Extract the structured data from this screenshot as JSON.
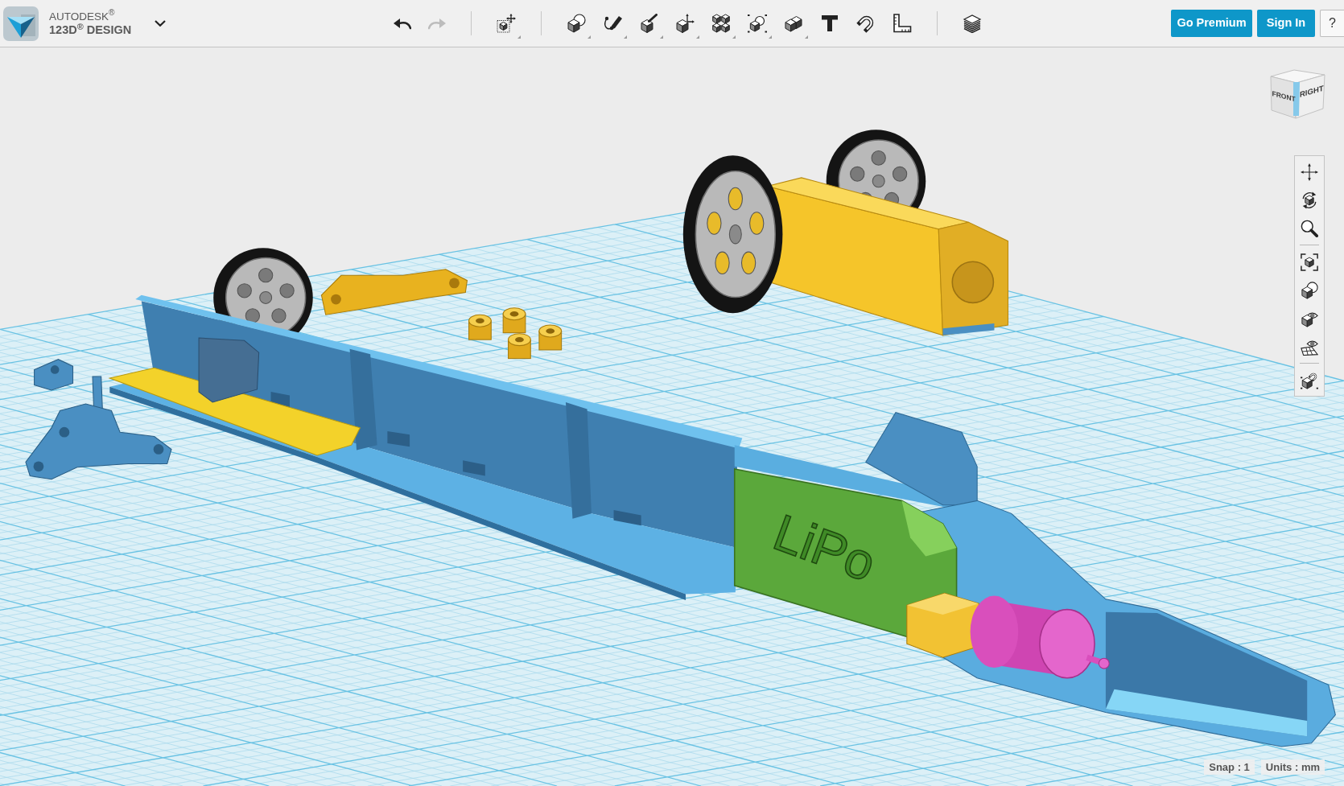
{
  "header": {
    "logo": {
      "brand": "AUTODESK$^{®}$",
      "product": "123D$^{®}$ DESIGN"
    },
    "toolbar_groups": [
      [
        {
          "kind": "undo",
          "disabled": false
        },
        {
          "kind": "redo",
          "disabled": true
        }
      ],
      [
        {
          "kind": "transform",
          "menu": true
        }
      ],
      [
        {
          "kind": "primitives",
          "menu": true
        },
        {
          "kind": "sketch",
          "menu": true
        },
        {
          "kind": "construct",
          "menu": true
        },
        {
          "kind": "modify",
          "menu": true
        },
        {
          "kind": "pattern",
          "menu": true
        },
        {
          "kind": "grouping",
          "menu": true
        },
        {
          "kind": "combine",
          "menu": true
        },
        {
          "kind": "text",
          "menu": false
        },
        {
          "kind": "snap",
          "menu": false
        },
        {
          "kind": "measure",
          "menu": false
        }
      ],
      [
        {
          "kind": "layers",
          "menu": false
        }
      ]
    ],
    "account_buttons": [
      "Go Premium",
      "Sign In"
    ],
    "help_button": "?"
  },
  "viewport": {
    "view_cube": {
      "faces": [
        "FRONT",
        "RIGHT"
      ]
    },
    "battery_label": "LiPo",
    "navigation_groups": [
      [
        {
          "kind": "pan"
        },
        {
          "kind": "orbit"
        },
        {
          "kind": "zoom"
        }
      ],
      [
        {
          "kind": "fit"
        },
        {
          "kind": "material"
        },
        {
          "kind": "visibility"
        },
        {
          "kind": "grid"
        }
      ],
      [
        {
          "kind": "snap"
        }
      ]
    ]
  },
  "status_bar": [
    "Snap : 1",
    "Units : mm"
  ]
}
